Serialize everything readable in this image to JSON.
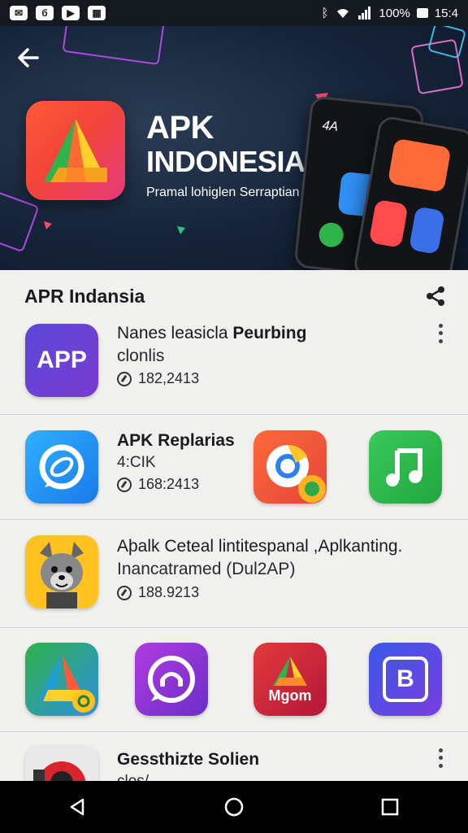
{
  "status_bar": {
    "battery": "100%",
    "time": "15:4",
    "icons": [
      "mail-icon",
      "notification-icon",
      "media-icon",
      "gallery-icon",
      "bluetooth-icon",
      "wifi-icon",
      "signal-icon",
      "battery-icon"
    ]
  },
  "banner": {
    "title_line1": "APK",
    "title_line2": "INDONESIA",
    "subtitle": "Pramal lohiglen Serraptian",
    "phone_text": "4A"
  },
  "list": {
    "title": "APR Indansia",
    "items": [
      {
        "title": "Nanes leasicla",
        "title_bold": "Peurbing",
        "subtitle": "clonlis",
        "downloads": "182,2413",
        "icon_label": "APP",
        "icon": "app-icon"
      },
      {
        "title": "APK Replarias",
        "subtitle": "4:CIK",
        "downloads": "168:2413",
        "icon": "messenger-icon"
      },
      {
        "title": "Aþalk Cetеal lintitespanal ,Aplkanting.",
        "subtitle": "Inancatramed (Dul2AP)",
        "downloads": "188.9213",
        "icon": "mascot-icon"
      },
      {
        "title": "Gessthizte Solien",
        "subtitle": "clos/",
        "icon": "robot-icon"
      }
    ],
    "grid_row_1": [
      {
        "name": "chrome-app",
        "icon": "chrome-icon"
      },
      {
        "name": "music-app",
        "icon": "music-icon"
      }
    ],
    "grid_row_2": [
      {
        "name": "drive-app",
        "icon": "drive-icon"
      },
      {
        "name": "chat-app",
        "icon": "chat-icon"
      },
      {
        "name": "mgom-app",
        "icon": "mgom-icon",
        "label": "Mgom"
      },
      {
        "name": "b-app",
        "icon": "b-icon",
        "label": "B"
      }
    ]
  },
  "colors": {
    "banner_bg": "#16243a",
    "accent_red": "#f2453a",
    "app_purple": "#6a3cc8",
    "music_green": "#2fb34a"
  }
}
